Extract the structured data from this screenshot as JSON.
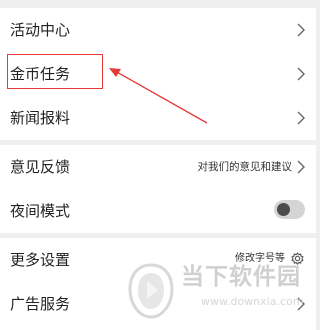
{
  "menu": {
    "group1": [
      {
        "label": "活动中心",
        "icon": "chevron-right-icon"
      },
      {
        "label": "金币任务",
        "icon": "chevron-right-icon"
      },
      {
        "label": "新闻报料",
        "icon": "chevron-right-icon"
      }
    ],
    "group2": [
      {
        "label": "意见反馈",
        "sub": "对我们的意见和建议",
        "icon": "chevron-right-icon"
      },
      {
        "label": "夜间模式",
        "toggle_on": false
      }
    ],
    "group3": [
      {
        "label": "更多设置",
        "sub": "修改字号等",
        "icon": "gear-icon"
      },
      {
        "label": "广告服务",
        "icon": "chevron-right-icon"
      }
    ]
  },
  "annotation": {
    "highlight_color": "#e53935",
    "target": "金币任务"
  },
  "watermark": {
    "title": "当下软件园",
    "url": "www.downxia.com"
  },
  "colors": {
    "background": "#efefef",
    "row_bg": "#ffffff",
    "text": "#222222",
    "chevron": "#666666",
    "watermark": "#d0d0d0"
  }
}
